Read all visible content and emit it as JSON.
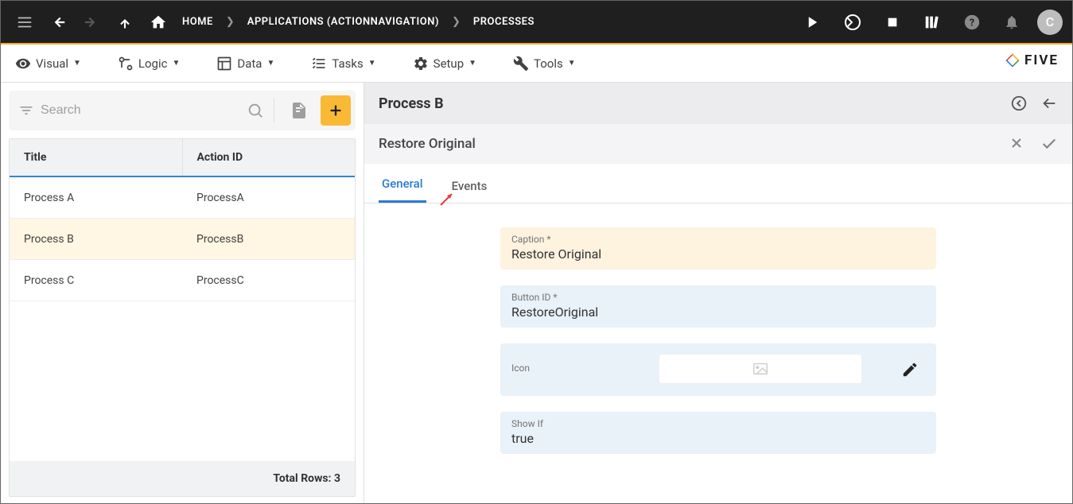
{
  "topbar": {
    "home_label": "HOME",
    "breadcrumbs": [
      "APPLICATIONS (ACTIONNAVIGATION)",
      "PROCESSES"
    ],
    "avatar_letter": "C"
  },
  "menubar": {
    "items": [
      {
        "label": "Visual"
      },
      {
        "label": "Logic"
      },
      {
        "label": "Data"
      },
      {
        "label": "Tasks"
      },
      {
        "label": "Setup"
      },
      {
        "label": "Tools"
      }
    ]
  },
  "logo_text": "FIVE",
  "sidebar": {
    "search_placeholder": "Search",
    "columns": [
      "Title",
      "Action ID"
    ],
    "rows": [
      {
        "title": "Process A",
        "action_id": "ProcessA",
        "selected": false
      },
      {
        "title": "Process B",
        "action_id": "ProcessB",
        "selected": true
      },
      {
        "title": "Process C",
        "action_id": "ProcessC",
        "selected": false
      }
    ],
    "footer": "Total Rows: 3"
  },
  "detail": {
    "title": "Process B",
    "subtitle": "Restore Original",
    "tabs": [
      {
        "label": "General",
        "active": true
      },
      {
        "label": "Events",
        "active": false
      }
    ],
    "fields": {
      "caption_label": "Caption *",
      "caption_value": "Restore Original",
      "button_id_label": "Button ID *",
      "button_id_value": "RestoreOriginal",
      "icon_label": "Icon",
      "show_if_label": "Show If",
      "show_if_value": "true"
    }
  }
}
